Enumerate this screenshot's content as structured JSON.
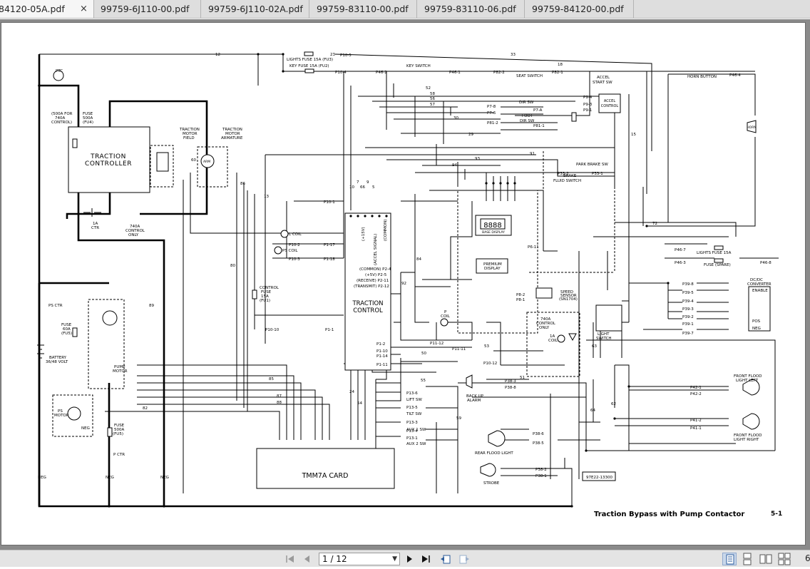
{
  "tabs": [
    {
      "label": "84120-05A.pdf",
      "active": true
    },
    {
      "label": "99759-6J110-00.pdf",
      "active": false
    },
    {
      "label": "99759-6J110-02A.pdf",
      "active": false
    },
    {
      "label": "99759-83110-00.pdf",
      "active": false
    },
    {
      "label": "99759-83110-06.pdf",
      "active": false
    },
    {
      "label": "99759-84120-00.pdf",
      "active": false
    }
  ],
  "tab_close_glyph": "×",
  "document": {
    "caption": "Traction Bypass with Pump Contactor",
    "page_code": "5-1",
    "drawing_number": "97E22-13300",
    "blocks": {
      "traction_controller": [
        "TRACTION",
        "CONTROLLER"
      ],
      "traction_control": [
        "TRACTION",
        "CONTROL"
      ],
      "tmm7a_card": "TMM7A CARD",
      "base_display": "BASE DISPLAY",
      "display_digits": "8888",
      "accel_control": [
        "ACCEL",
        "CONTROL"
      ],
      "horn": "HORN"
    },
    "labels": {
      "lights_fuse_15a_fu3": "LIGHTS FUSE 15A (FU3)",
      "key_fuse_15a_fu2": "KEY FUSE 15A (FU2)",
      "key_switch": "KEY SWITCH",
      "seat_switch": "SEAT SWITCH",
      "accel_start_sw": [
        "ACCEL",
        "START SW"
      ],
      "horn_button": "HORN BUTTON",
      "dir_sw": "DIR SW",
      "foot_dir_sw": [
        "FOOT",
        "DIR SW"
      ],
      "park_brake_sw": "PARK BRAKE SW",
      "brake_fluid_switch": [
        "BRAKE",
        "FLUID SWITCH"
      ],
      "ptc": "PTC",
      "fuse_500a": [
        "FUSE",
        "500A",
        "(FU4)"
      ],
      "note_500a_for_740a": [
        "(500A FOR",
        "740A",
        "CONTROL)"
      ],
      "traction_motor_field": [
        "TRACTION",
        "MOTOR",
        "FIELD"
      ],
      "traction_motor_armature": [
        "TRACTION",
        "MOTOR",
        "ARMATURE"
      ],
      "ctr_1a": [
        "1A",
        "CTR"
      ],
      "control_only_740a": [
        "740A",
        "CONTROL",
        "ONLY"
      ],
      "l_coil": "L COIL",
      "ps_coil": "PS COIL",
      "control_fuse_15a_fu1": [
        "CONTROL",
        "FUSE",
        "15A",
        "(FU1)"
      ],
      "ps_ctr": "PS CTR",
      "fuse_60a_fu5": [
        "FUSE",
        "60A",
        "(FU5)"
      ],
      "battery": [
        "BATTERY",
        "36/48 VOLT"
      ],
      "pump_motor": [
        "PUMP",
        "MOTOR"
      ],
      "ps_motor": [
        "PS",
        "MOTOR"
      ],
      "fuse_500a_fu5": [
        "FUSE",
        "500A",
        "(FU5)"
      ],
      "p_ctr": "P CTR",
      "p_coil": [
        "P",
        "COIL"
      ],
      "control_only_740a_box": [
        "740A",
        "CONTROL",
        "ONLY"
      ],
      "coil_1a": [
        "1A",
        "COIL"
      ],
      "light_switch": [
        "LIGHT",
        "SWITCH"
      ],
      "lights_fuse_15a": "LIGHTS FUSE 15A",
      "fuse_spare": "FUSE (SPARE)",
      "dc_dc_converter": [
        "DC/DC",
        "CONVERTER"
      ],
      "enable": "ENABLE",
      "pos": "POS",
      "neg": "NEG",
      "speed_sensor": [
        "SPEED",
        "SENSOR",
        "(SN1704)"
      ],
      "premium_display": [
        "PREMIUM",
        "DISPLAY"
      ],
      "back_up_alarm": [
        "BACK UP",
        "ALARM"
      ],
      "rear_flood_light": "REAR FLOOD LIGHT",
      "strobe": "STROBE",
      "front_flood_light_left": [
        "FRONT FLOOD",
        "LIGHT LEFT"
      ],
      "front_flood_light_right": [
        "FRONT FLOOD",
        "LIGHT RIGHT"
      ],
      "lift_sw": "LIFT SW",
      "tilt_sw": "TILT SW",
      "aux1_sw": "AUX 1 SW",
      "aux2_sw": "AUX 2 SW",
      "common_p2_4": "(COMMON) P2-4",
      "v15_p2_5": "(+5V) P2-5",
      "receive_p2_11": "(RECEIVE) P2-11",
      "transmit_p2_12": "(TRANSMIT) P2-12",
      "accel_signal": "(ACCEL SIGNAL)",
      "v15": "(+15V)",
      "common": "(COMMON)",
      "neg_1": "NEG",
      "neg_2": "NEG",
      "neg_3": "NEG",
      "arm": "ARM"
    },
    "connectors": {
      "p10_1": "P10-1",
      "p1_17": "P1-17",
      "p10_2": "P10-2",
      "p1_18": "P1-18",
      "p10_3": "P10-3",
      "p10_10": "P10-10",
      "p1_1": "P1-1",
      "p1_2": "P1-2",
      "p1_10": "P1-10",
      "p1_14": "P1-14",
      "p1_11": "P1-11",
      "p10_5": "P10-5",
      "p10_4": "P10-4",
      "p46_2": "P46-2",
      "p46_1": "P46-1",
      "p82_2": "P82-2",
      "p82_1": "P82-1",
      "p46_4": "P46-4",
      "p9_4": "P9-4",
      "p9_3": "P9-3",
      "p9_1": "P9-1",
      "p7_8": "P7-8",
      "p7_6": "P7-6",
      "p7_a": "P7-A",
      "p81_2": "P81-2",
      "p81_1": "P81-1",
      "p33_2": "P33-2",
      "p33_1": "P33-1",
      "p46_7": "P46-7",
      "p46_3": "P46-3",
      "p46_8": "P46-8",
      "p39_8": "P39-8",
      "p39_5": "P39-5",
      "p39_4": "P39-4",
      "p39_3": "P39-3",
      "p39_2": "P39-2",
      "p39_1": "P39-1",
      "p39_7": "P39-7",
      "p11_12": "P11-12",
      "p11_11": "P11-11",
      "p10_12": "P10-12",
      "p38_3": "P38-3",
      "p38_8": "P38-8",
      "p38_6": "P38-6",
      "p38_5": "P38-5",
      "p38_2": "P38-2",
      "p38_1": "P38-1",
      "p42_1": "P42-1",
      "p42_2": "P42-2",
      "p41_2": "P41-2",
      "p41_1": "P41-1",
      "p13_6": "P13-6",
      "p13_5": "P13-5",
      "p13_3": "P13-3",
      "p13_4": "P13-4",
      "p13_1": "P13-1",
      "p6_11": "P6-11",
      "p8_2": "P8-2",
      "p8_1": "P8-1"
    },
    "wires": [
      "12",
      "33",
      "13",
      "18",
      "52",
      "58",
      "56",
      "57",
      "29",
      "15",
      "30",
      "10",
      "7",
      "66",
      "9",
      "5",
      "24",
      "85",
      "86",
      "60",
      "80",
      "82",
      "87",
      "88",
      "89",
      "72",
      "94",
      "93",
      "91",
      "84",
      "63",
      "64",
      "62",
      "53",
      "50",
      "55",
      "54",
      "59",
      "51",
      "92",
      "23"
    ]
  },
  "toolbar": {
    "page_indicator": "1 / 12",
    "right_edge": "6"
  }
}
